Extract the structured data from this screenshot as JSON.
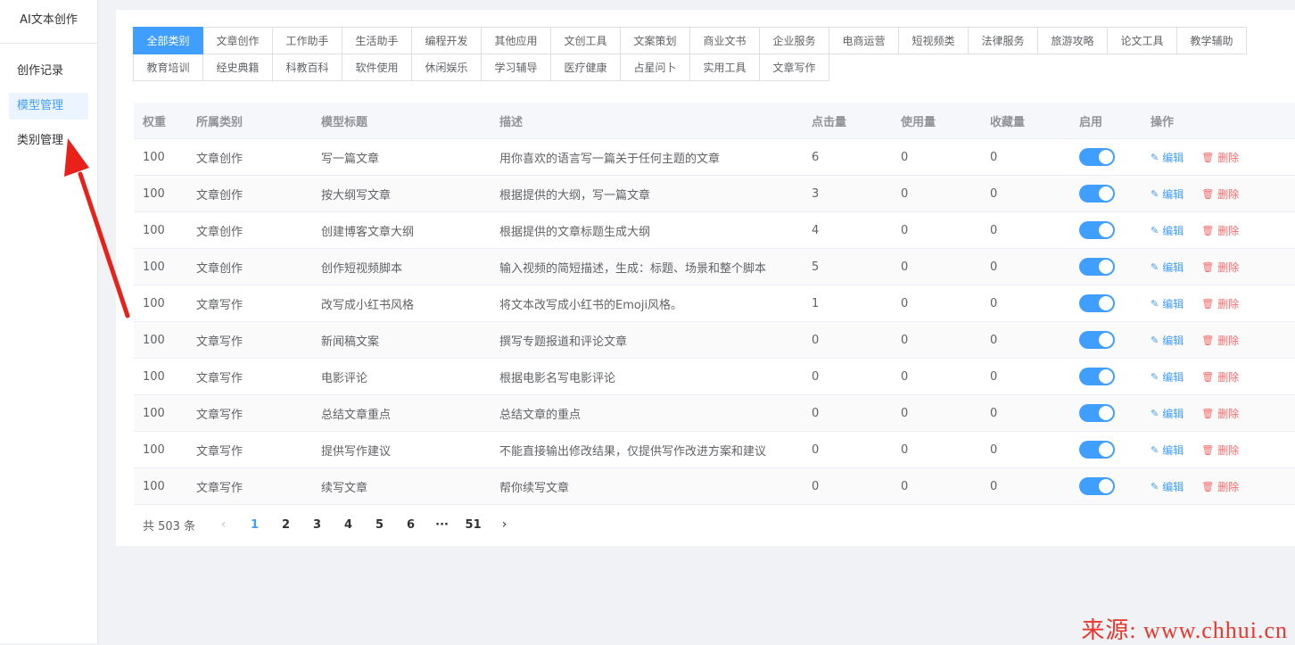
{
  "app_title": "AI文本创作",
  "sidebar": {
    "items": [
      {
        "label": "创作记录",
        "active": false
      },
      {
        "label": "模型管理",
        "active": true
      },
      {
        "label": "类别管理",
        "active": false
      }
    ]
  },
  "categories": [
    "全部类别",
    "文章创作",
    "工作助手",
    "生活助手",
    "编程开发",
    "其他应用",
    "文创工具",
    "文案策划",
    "商业文书",
    "企业服务",
    "电商运营",
    "短视频类",
    "法律服务",
    "旅游攻略",
    "论文工具",
    "教学辅助",
    "教育培训",
    "经史典籍",
    "科教百科",
    "软件使用",
    "休闲娱乐",
    "学习辅导",
    "医疗健康",
    "占星问卜",
    "实用工具",
    "文章写作"
  ],
  "active_category": "全部类别",
  "table": {
    "headers": [
      "权重",
      "所属类别",
      "模型标题",
      "描述",
      "点击量",
      "使用量",
      "收藏量",
      "启用",
      "操作"
    ],
    "rows": [
      [
        "100",
        "文章创作",
        "写一篇文章",
        "用你喜欢的语言写一篇关于任何主题的文章",
        "6",
        "0",
        "0"
      ],
      [
        "100",
        "文章创作",
        "按大纲写文章",
        "根据提供的大纲，写一篇文章",
        "3",
        "0",
        "0"
      ],
      [
        "100",
        "文章创作",
        "创建博客文章大纲",
        "根据提供的文章标题生成大纲",
        "4",
        "0",
        "0"
      ],
      [
        "100",
        "文章创作",
        "创作短视频脚本",
        "输入视频的简短描述，生成：标题、场景和整个脚本",
        "5",
        "0",
        "0"
      ],
      [
        "100",
        "文章写作",
        "改写成小红书风格",
        "将文本改写成小红书的Emoji风格。",
        "1",
        "0",
        "0"
      ],
      [
        "100",
        "文章写作",
        "新闻稿文案",
        "撰写专题报道和评论文章",
        "0",
        "0",
        "0"
      ],
      [
        "100",
        "文章写作",
        "电影评论",
        "根据电影名写电影评论",
        "0",
        "0",
        "0"
      ],
      [
        "100",
        "文章写作",
        "总结文章重点",
        "总结文章的重点",
        "0",
        "0",
        "0"
      ],
      [
        "100",
        "文章写作",
        "提供写作建议",
        "不能直接输出修改结果，仅提供写作改进方案和建议",
        "0",
        "0",
        "0"
      ],
      [
        "100",
        "文章写作",
        "续写文章",
        "帮你续写文章",
        "0",
        "0",
        "0"
      ]
    ],
    "enabled": [
      true,
      true,
      true,
      true,
      true,
      true,
      true,
      true,
      true,
      true
    ],
    "edit_label": "编辑",
    "delete_label": "删除"
  },
  "pagination": {
    "total_text": "共 503 条",
    "pages": [
      "1",
      "2",
      "3",
      "4",
      "5",
      "6",
      "···",
      "51"
    ],
    "current": "1"
  },
  "colors": {
    "primary": "#409eff",
    "danger": "#f56c6c",
    "arrow": "#e8221b"
  },
  "watermark": "来源: www.chhui.cn"
}
